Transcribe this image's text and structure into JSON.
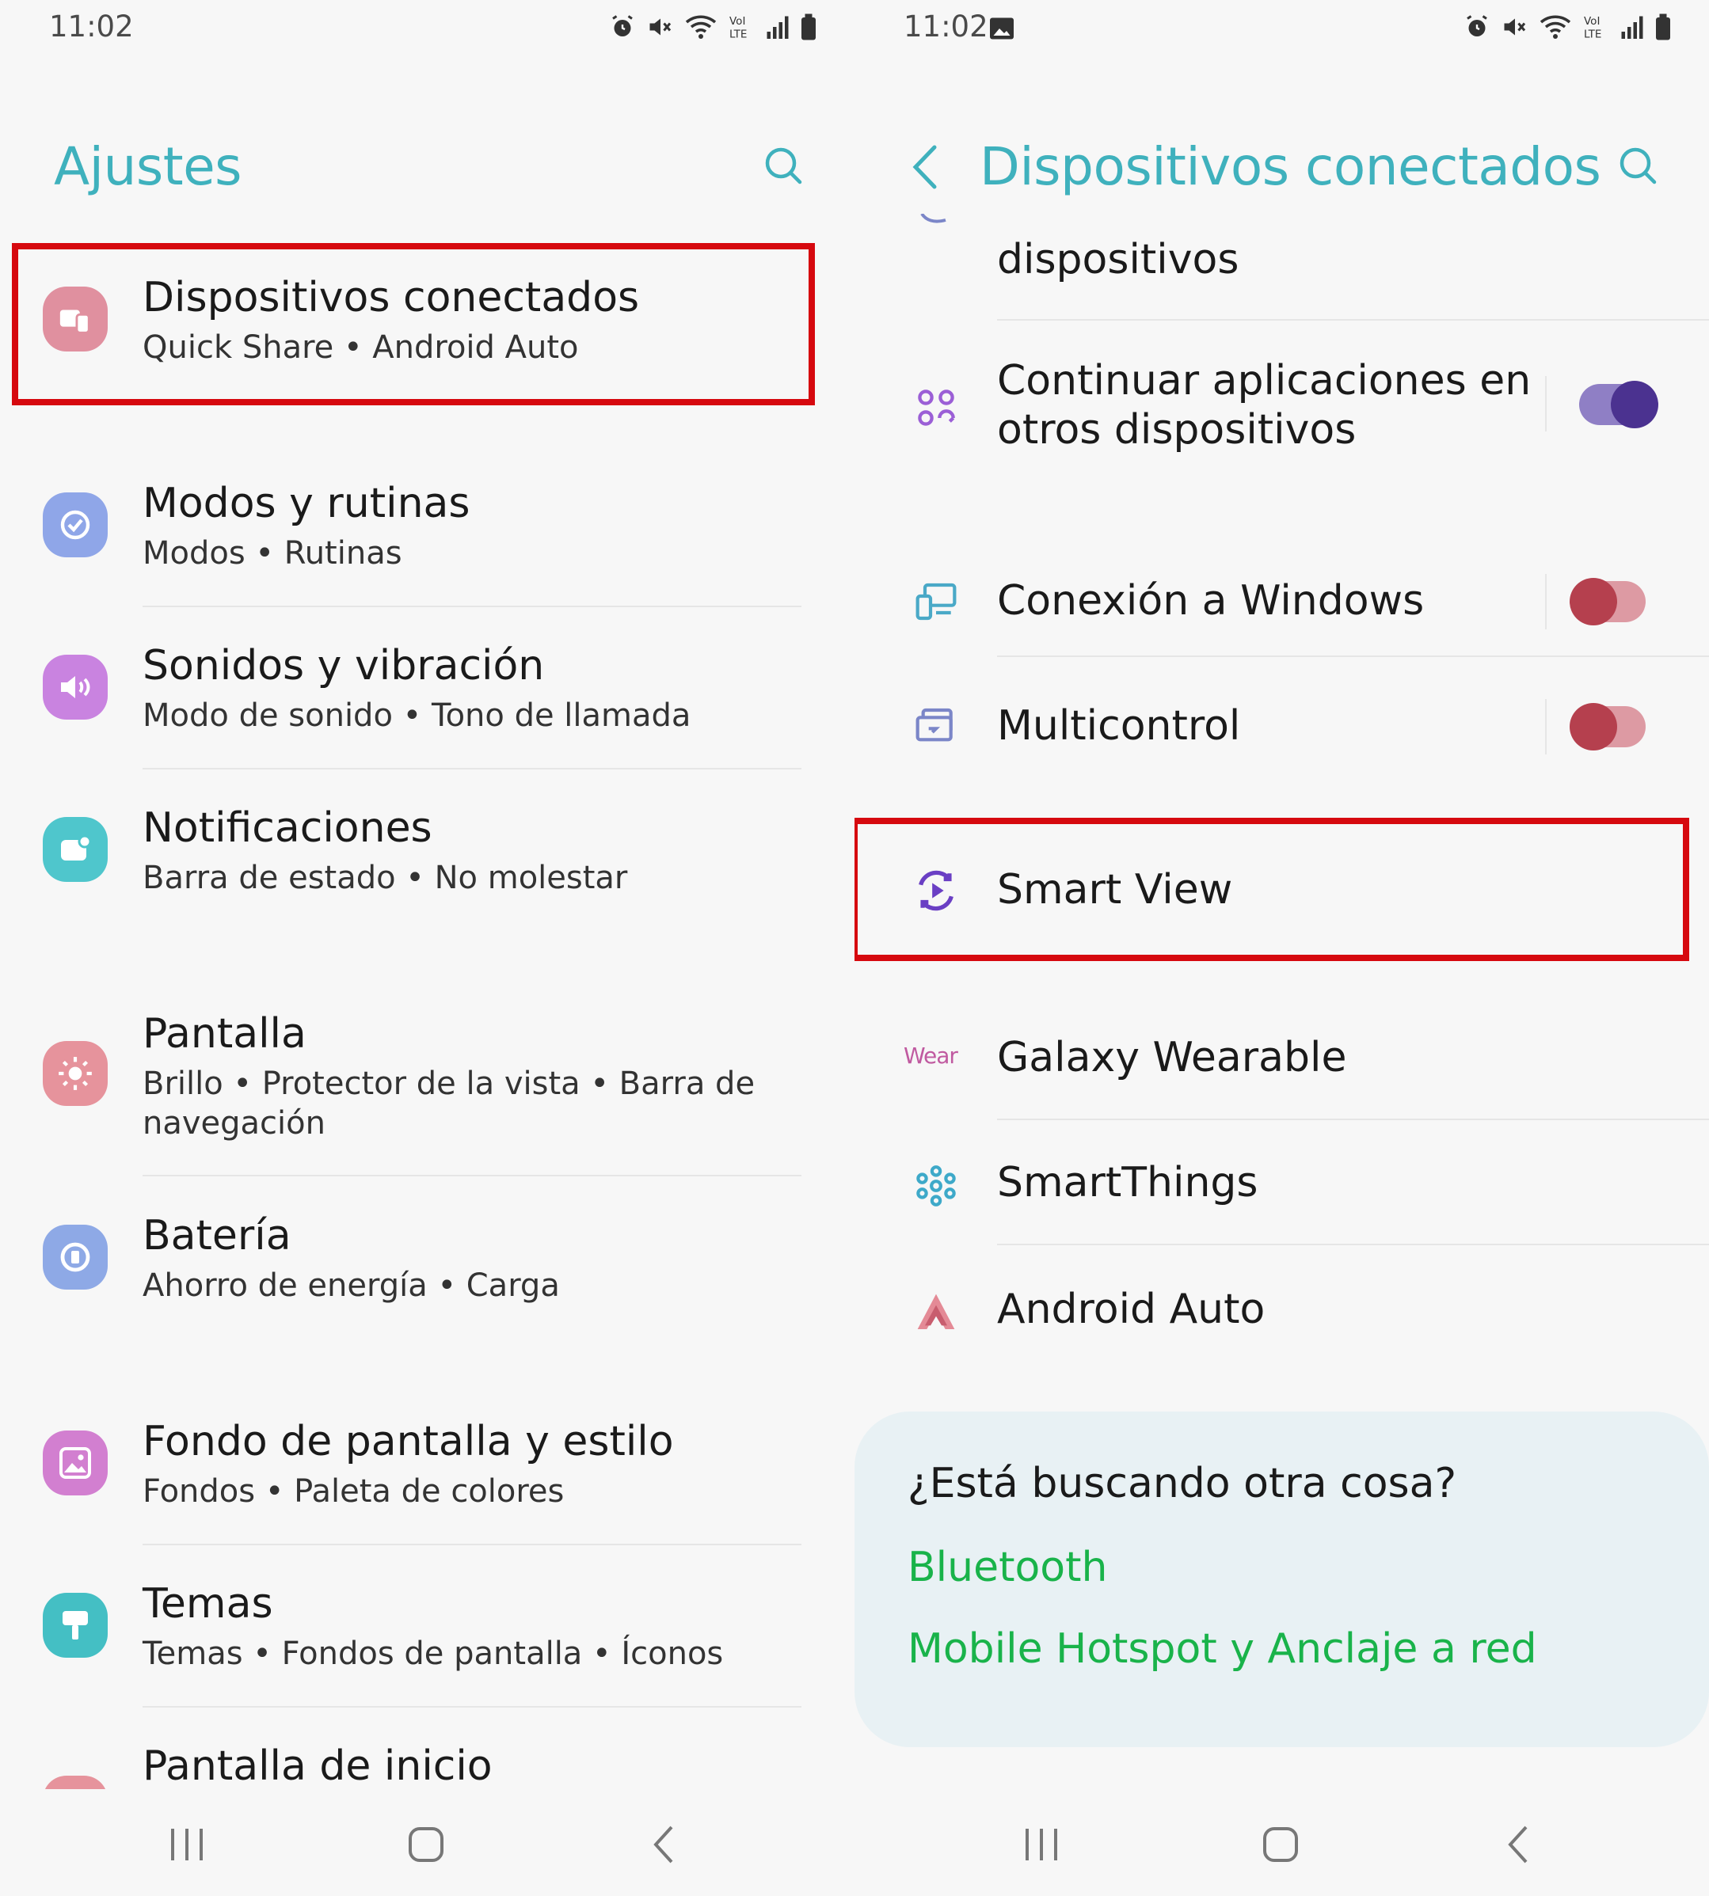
{
  "left": {
    "status": {
      "time": "11:02"
    },
    "header": {
      "title": "Ajustes"
    },
    "items": [
      {
        "title": "Dispositivos conectados",
        "subtitle": "Quick Share  •  Android Auto",
        "color": "#e0909f"
      },
      {
        "title": "Modos y rutinas",
        "subtitle": "Modos  •  Rutinas",
        "color": "#8fa6e8"
      },
      {
        "title": "Sonidos y vibración",
        "subtitle": "Modo de sonido  •  Tono de llamada",
        "color": "#c983e0"
      },
      {
        "title": "Notificaciones",
        "subtitle": "Barra de estado  •  No molestar",
        "color": "#4fc6cc"
      },
      {
        "title": "Pantalla",
        "subtitle": "Brillo  •  Protector de la vista  •  Barra de navegación",
        "color": "#e6939c"
      },
      {
        "title": "Batería",
        "subtitle": "Ahorro de energía  •  Carga",
        "color": "#8ea9e6"
      },
      {
        "title": "Fondo de pantalla y estilo",
        "subtitle": "Fondos  •  Paleta de colores",
        "color": "#d27fd0"
      },
      {
        "title": "Temas",
        "subtitle": "Temas  •  Fondos de pantalla  •  Íconos",
        "color": "#44bfc4"
      },
      {
        "title": "Pantalla de inicio",
        "subtitle": "",
        "color": "#e6939c"
      }
    ]
  },
  "right": {
    "status": {
      "time": "11:02"
    },
    "header": {
      "title": "Dispositivos conectados"
    },
    "items": [
      {
        "title": "dispositivos"
      },
      {
        "title": "Continuar aplicaciones en otros dispositivos",
        "toggle": "on"
      },
      {
        "title": "Conexión a Windows",
        "toggle": "off"
      },
      {
        "title": "Multicontrol",
        "toggle": "off"
      },
      {
        "title": "Smart View"
      },
      {
        "title": "Galaxy Wearable",
        "icon_text": "Wear"
      },
      {
        "title": "SmartThings"
      },
      {
        "title": "Android Auto"
      }
    ],
    "suggest": {
      "title": "¿Está buscando otra cosa?",
      "links": [
        "Bluetooth",
        "Mobile Hotspot y Anclaje a red"
      ]
    }
  },
  "colors": {
    "accent": "#3fb1bd",
    "highlight": "#d6090f",
    "link": "#19b34a",
    "toggle_on": "#4b3290",
    "toggle_off": "#b5404e"
  }
}
